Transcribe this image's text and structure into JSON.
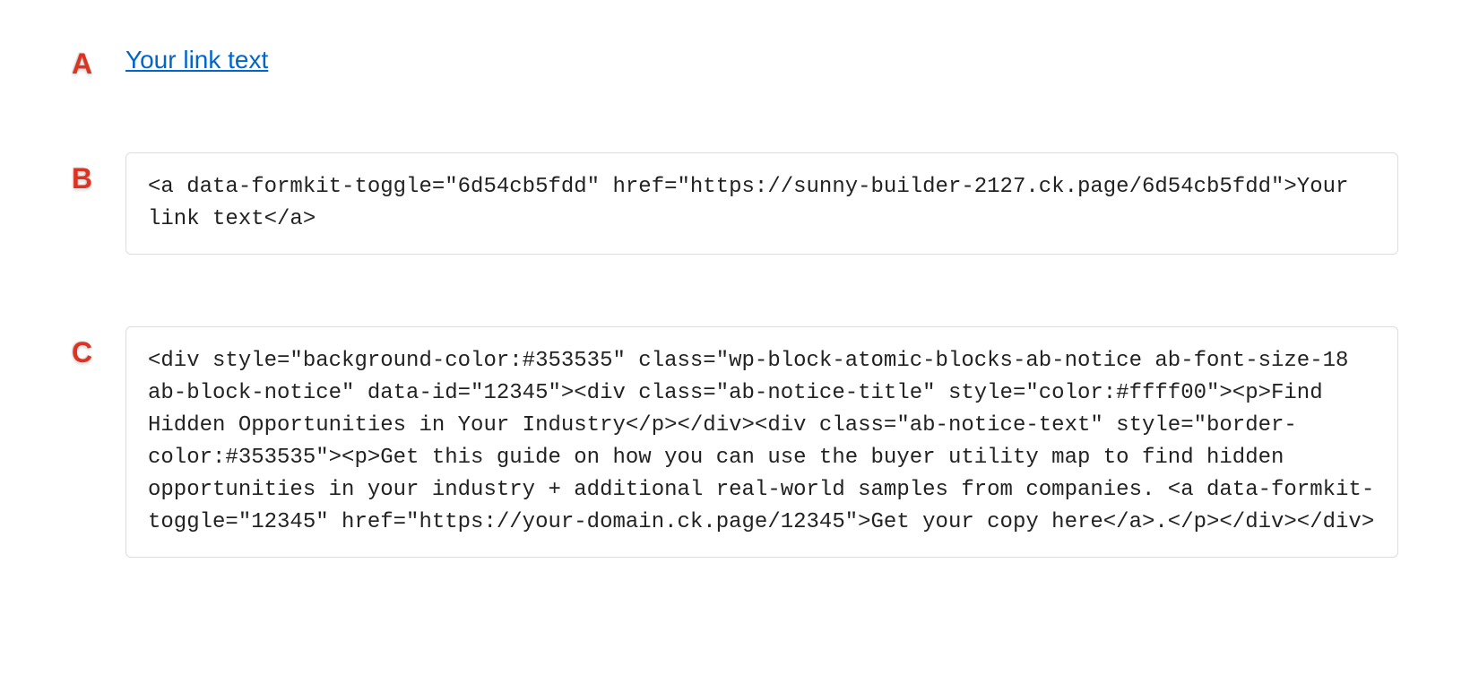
{
  "labels": {
    "a": "A",
    "b": "B",
    "c": "C"
  },
  "link": {
    "text": "Your link text"
  },
  "codeB": "<a data-formkit-toggle=\"6d54cb5fdd\" href=\"https://sunny-builder-2127.ck.page/6d54cb5fdd\">Your link text</a>",
  "codeC": "<div style=\"background-color:#353535\" class=\"wp-block-atomic-blocks-ab-notice ab-font-size-18 ab-block-notice\" data-id=\"12345\"><div class=\"ab-notice-title\" style=\"color:#ffff00\"><p>Find Hidden Opportunities in Your Industry</p></div><div class=\"ab-notice-text\" style=\"border-color:#353535\"><p>Get this guide on how you can use the buyer utility map to find hidden opportunities in your industry + additional real-world samples from companies. <a data-formkit-toggle=\"12345\" href=\"https://your-domain.ck.page/12345\">Get your copy here</a>.</p></div></div>"
}
